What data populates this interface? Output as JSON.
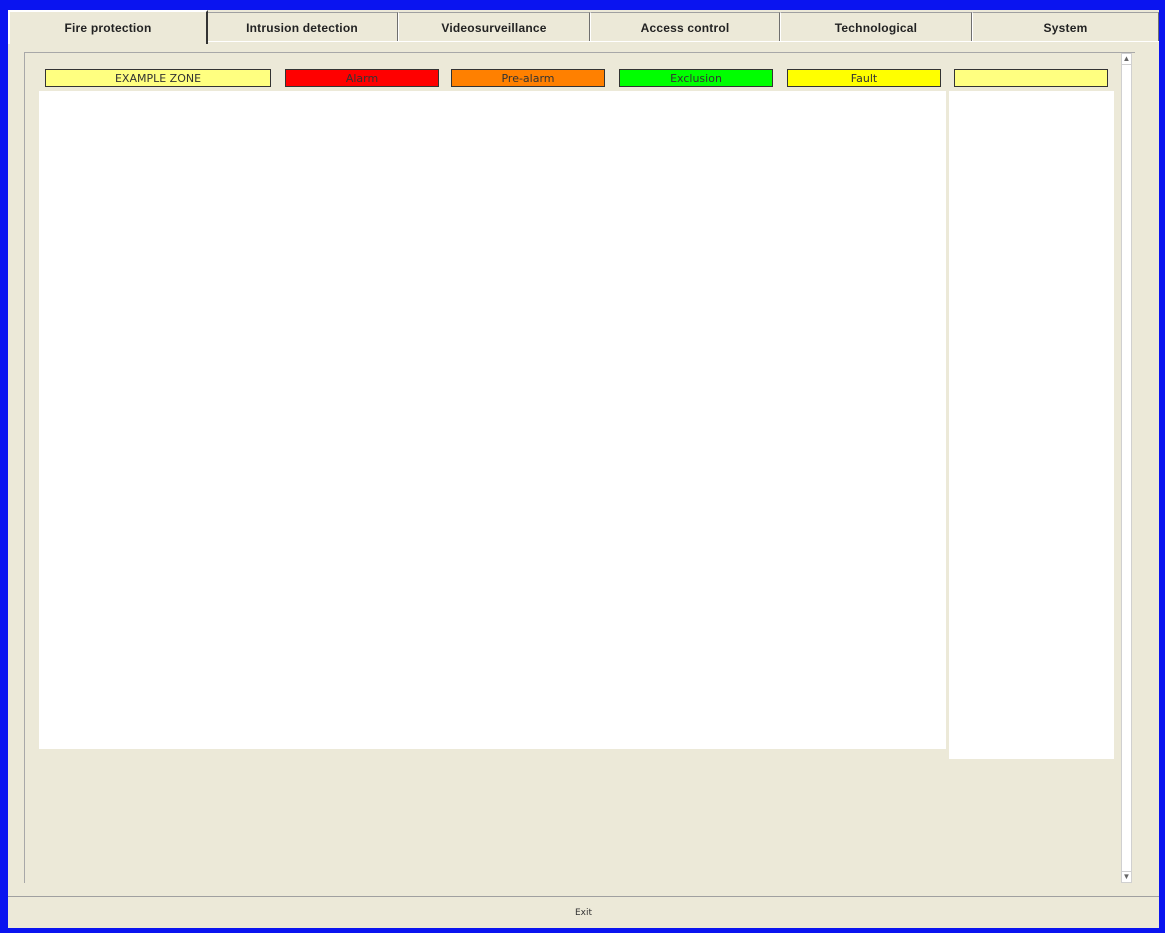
{
  "tabs": [
    {
      "label": "Fire protection",
      "active": true
    },
    {
      "label": "Intrusion detection",
      "active": false
    },
    {
      "label": "Videosurveillance",
      "active": false
    },
    {
      "label": "Access control",
      "active": false
    },
    {
      "label": "Technological",
      "active": false
    },
    {
      "label": "System",
      "active": false
    }
  ],
  "legend": {
    "zone": {
      "label": "EXAMPLE ZONE",
      "color": "#ffff80"
    },
    "alarm": {
      "label": "Alarm",
      "color": "#ff0000"
    },
    "prealarm": {
      "label": "Pre-alarm",
      "color": "#ff8000"
    },
    "exclusion": {
      "label": "Exclusion",
      "color": "#00ff00"
    },
    "fault": {
      "label": "Fault",
      "color": "#ffff00"
    },
    "blank": {
      "label": "",
      "color": "#ffff80"
    }
  },
  "footer": {
    "exit_label": "Exit"
  },
  "colors": {
    "window_border": "#0a14f0",
    "background": "#ece9d8"
  }
}
